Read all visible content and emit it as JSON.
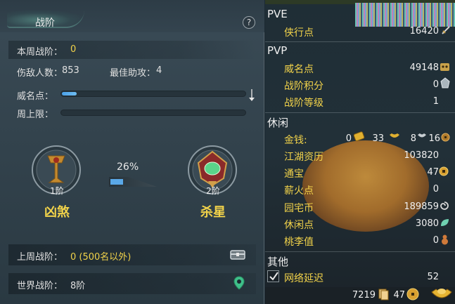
{
  "title": "战阶",
  "help_label": "?",
  "weekly_rank": {
    "label": "本周战阶：",
    "value": "0"
  },
  "stats": {
    "kills_label": "伤敌人数：",
    "kills_value": "853",
    "assists_label": "最佳助攻：",
    "assists_value": "4"
  },
  "fame": {
    "label": "威名点：",
    "progress": 0.08
  },
  "weekly_cap": {
    "label": "周上限："
  },
  "current_tier": {
    "level": "1阶",
    "name": "凶煞"
  },
  "next_tier": {
    "level": "2阶",
    "name": "杀星"
  },
  "tier_progress": {
    "pct_text": "26%",
    "progress": 0.26
  },
  "last_week": {
    "label": "上周战阶：",
    "value": "0 (500名以外)"
  },
  "world_rank": {
    "label": "世界战阶：",
    "value": "8阶"
  },
  "colors": {
    "accent_yellow": "#f2d34a",
    "bar_blue": "#5aa8e8"
  },
  "right": {
    "pve": {
      "head": "PVE",
      "items": [
        {
          "label": "侠行点",
          "value": "16420",
          "icon": "sword-icon"
        }
      ]
    },
    "pvp": {
      "head": "PVP",
      "items": [
        {
          "label": "威名点",
          "value": "49148",
          "icon": "mask-icon"
        },
        {
          "label": "战阶积分",
          "value": "0",
          "icon": "helmet-icon"
        },
        {
          "label": "战阶等级",
          "value": "1"
        }
      ]
    },
    "leisure": {
      "head": "休闲",
      "money_label": "金钱:",
      "money": {
        "gold": "0",
        "silver": "33",
        "copper": "8",
        "yuanbao": "16"
      },
      "items": [
        {
          "label": "江湖资历",
          "value": "103820"
        },
        {
          "label": "通宝",
          "value": "47",
          "icon": "coin-icon"
        },
        {
          "label": "薪火点",
          "value": "0"
        },
        {
          "label": "园宅币",
          "value": "189859",
          "icon": "swirl-icon"
        },
        {
          "label": "休闲点",
          "value": "3080",
          "icon": "leaf-icon"
        },
        {
          "label": "桃李值",
          "value": "0",
          "icon": "gourd-icon"
        }
      ]
    },
    "other": {
      "head": "其他",
      "latency_label": "网络延迟",
      "latency_value": "52"
    },
    "footer": {
      "cards": "7219",
      "coins": "47"
    }
  }
}
